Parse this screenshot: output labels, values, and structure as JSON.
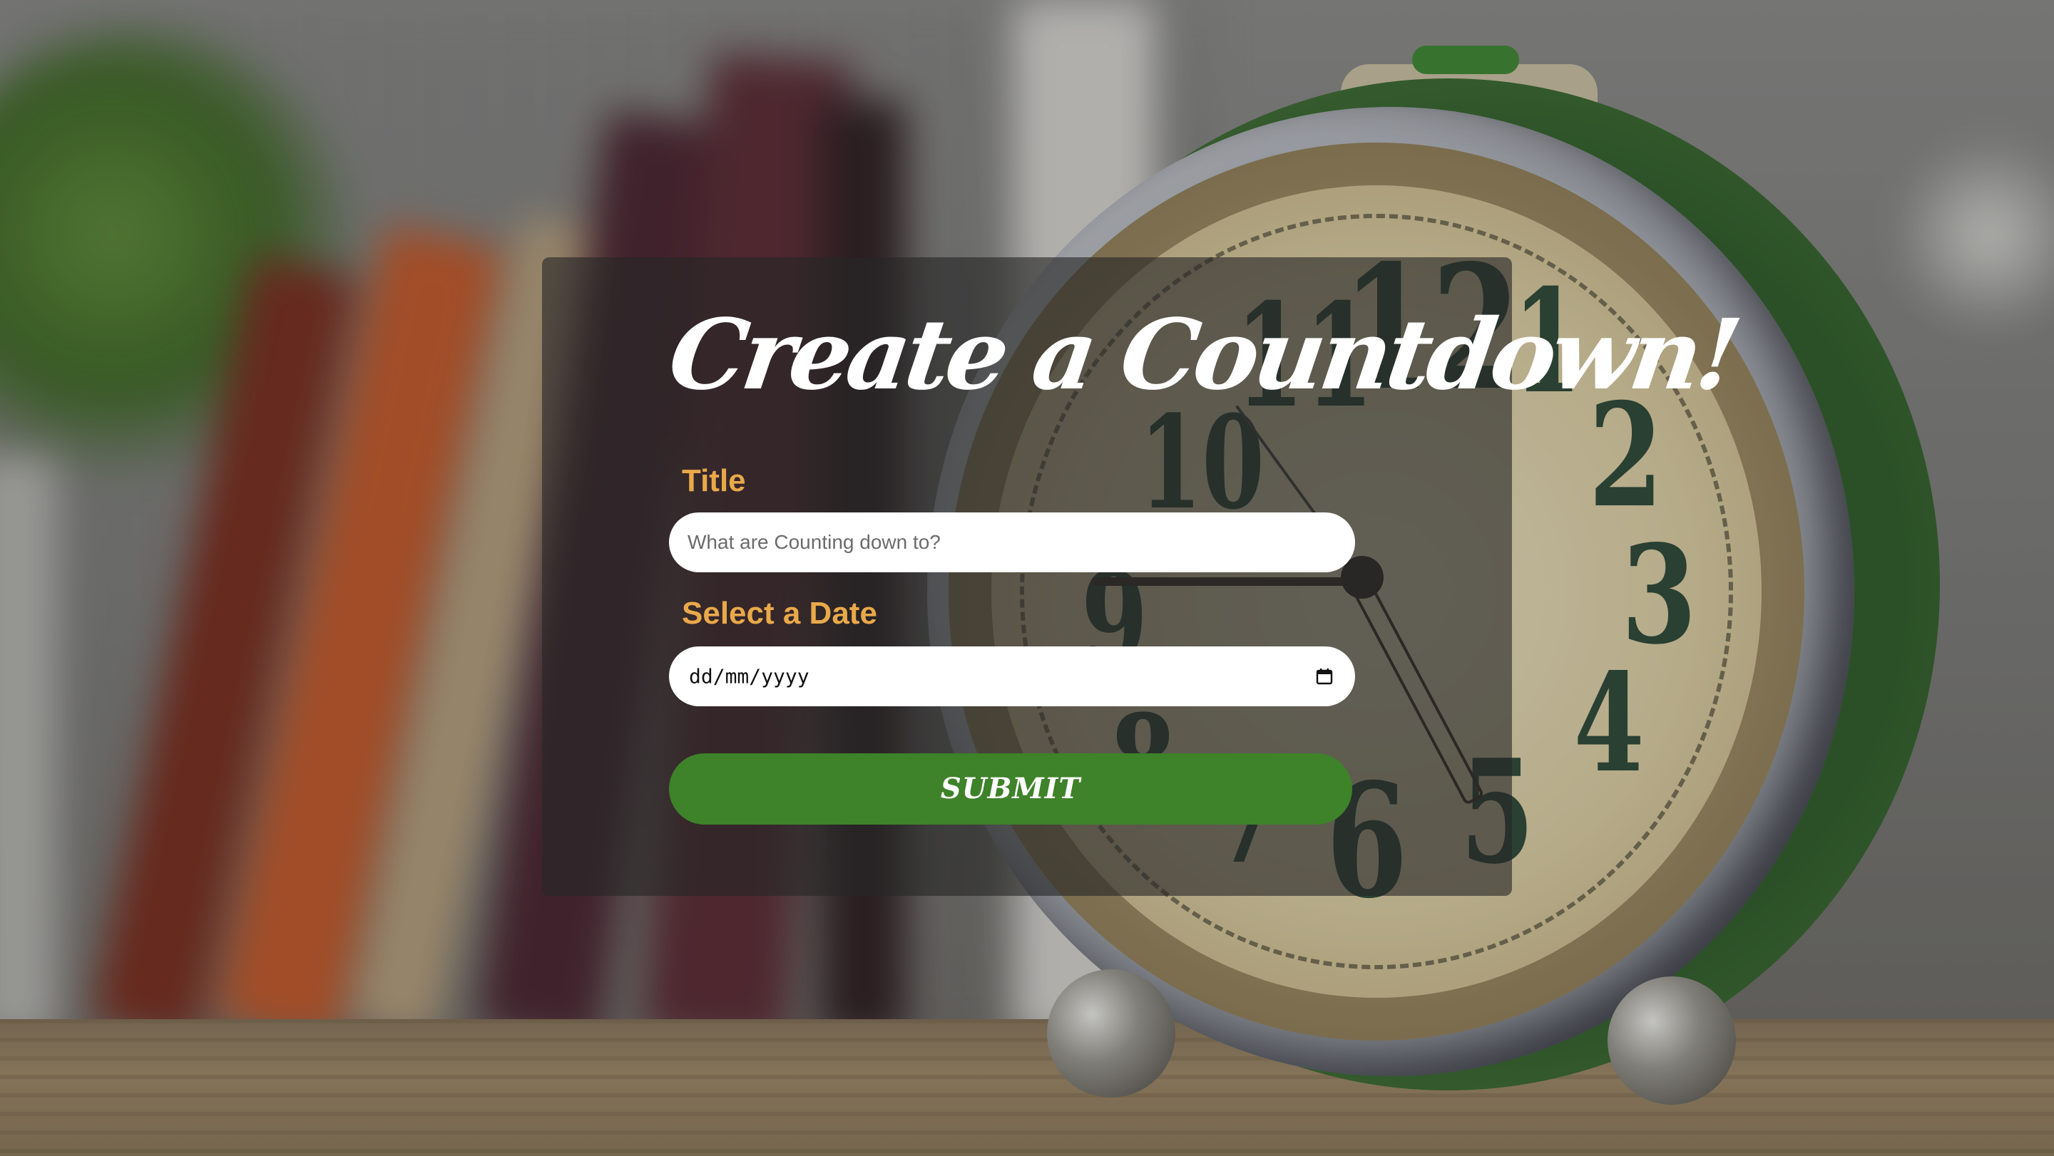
{
  "form": {
    "heading": "Create a Countdown!",
    "title_field": {
      "label": "Title",
      "placeholder": "What are Counting down to?",
      "value": ""
    },
    "date_field": {
      "label": "Select a Date",
      "value": "dd/mm/yyyy",
      "icon": "calendar-icon"
    },
    "submit_label": "SUBMIT"
  },
  "background": {
    "description_icon": "alarm-clock-photo"
  },
  "colors": {
    "label": "#e9a94a",
    "submit": "#3e8229",
    "card": "rgba(38,38,38,0.62)",
    "heading": "#ffffff"
  }
}
